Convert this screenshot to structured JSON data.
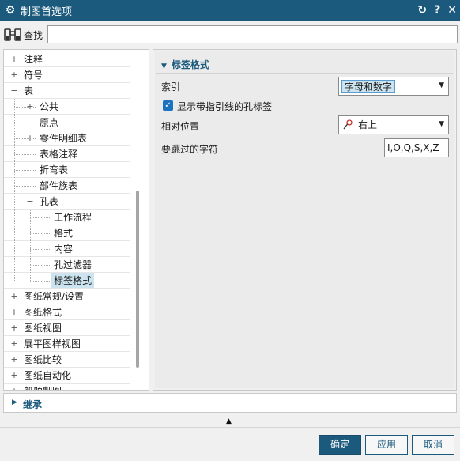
{
  "window": {
    "title": "制图首选项"
  },
  "search": {
    "label": "查找",
    "value": ""
  },
  "tree": [
    {
      "label": "注释",
      "level": 0,
      "expander": "+"
    },
    {
      "label": "符号",
      "level": 0,
      "expander": "+"
    },
    {
      "label": "表",
      "level": 0,
      "expander": "−"
    },
    {
      "label": "公共",
      "level": 1,
      "expander": "+"
    },
    {
      "label": "原点",
      "level": 1,
      "expander": ""
    },
    {
      "label": "零件明细表",
      "level": 1,
      "expander": "+"
    },
    {
      "label": "表格注释",
      "level": 1,
      "expander": ""
    },
    {
      "label": "折弯表",
      "level": 1,
      "expander": ""
    },
    {
      "label": "部件族表",
      "level": 1,
      "expander": ""
    },
    {
      "label": "孔表",
      "level": 1,
      "expander": "−"
    },
    {
      "label": "工作流程",
      "level": 2,
      "expander": ""
    },
    {
      "label": "格式",
      "level": 2,
      "expander": ""
    },
    {
      "label": "内容",
      "level": 2,
      "expander": ""
    },
    {
      "label": "孔过滤器",
      "level": 2,
      "expander": ""
    },
    {
      "label": "标签格式",
      "level": 2,
      "expander": "",
      "selected": true
    },
    {
      "label": "图纸常规/设置",
      "level": 0,
      "expander": "+"
    },
    {
      "label": "图纸格式",
      "level": 0,
      "expander": "+"
    },
    {
      "label": "图纸视图",
      "level": 0,
      "expander": "+"
    },
    {
      "label": "展平图样视图",
      "level": 0,
      "expander": "+"
    },
    {
      "label": "图纸比较",
      "level": 0,
      "expander": "+"
    },
    {
      "label": "图纸自动化",
      "level": 0,
      "expander": "+"
    },
    {
      "label": "船舶制图",
      "level": 0,
      "expander": "+"
    }
  ],
  "panel": {
    "section_title": "标签格式",
    "index_label": "索引",
    "index_value": "字母和数字",
    "show_leader_label": "显示带指引线的孔标签",
    "show_leader_checked": true,
    "rel_pos_label": "相对位置",
    "rel_pos_value": "右上",
    "skip_label": "要跳过的字符",
    "skip_value": "I,O,Q,S,X,Z"
  },
  "inherit": {
    "label": "继承"
  },
  "buttons": {
    "ok": "确定",
    "apply": "应用",
    "cancel": "取消"
  },
  "colors": {
    "titlebar": "#1b5a7d",
    "accent": "#1b5a7d",
    "selection": "#cce4f0"
  }
}
